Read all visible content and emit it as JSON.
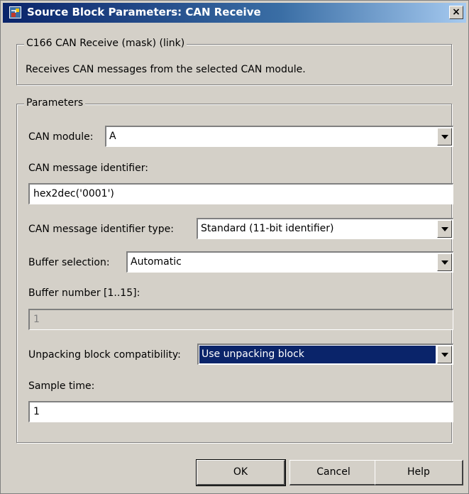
{
  "window": {
    "title": "Source Block Parameters: CAN Receive",
    "close_label": "×"
  },
  "mask": {
    "legend": "C166 CAN Receive (mask) (link)",
    "description": "Receives CAN messages from the selected CAN module."
  },
  "parameters": {
    "legend": "Parameters",
    "can_module": {
      "label": "CAN module:",
      "value": "A"
    },
    "message_identifier": {
      "label": "CAN message identifier:",
      "value": "hex2dec('0001')"
    },
    "identifier_type": {
      "label": "CAN message identifier type:",
      "value": "Standard (11-bit identifier)"
    },
    "buffer_selection": {
      "label": "Buffer selection:",
      "value": "Automatic"
    },
    "buffer_number": {
      "label": "Buffer number [1..15]:",
      "value": "1"
    },
    "unpacking": {
      "label": "Unpacking block compatibility:",
      "value": "Use unpacking block"
    },
    "sample_time": {
      "label": "Sample time:",
      "value": "1"
    }
  },
  "buttons": {
    "ok": "OK",
    "cancel": "Cancel",
    "help": "Help"
  },
  "colors": {
    "titlebar_start": "#0a246a",
    "titlebar_end": "#a6caf0",
    "dialog_face": "#d4d0c8",
    "selection": "#0a246a"
  },
  "icons": {
    "title": "simulink-block-icon",
    "combo": "chevron-down-icon"
  }
}
